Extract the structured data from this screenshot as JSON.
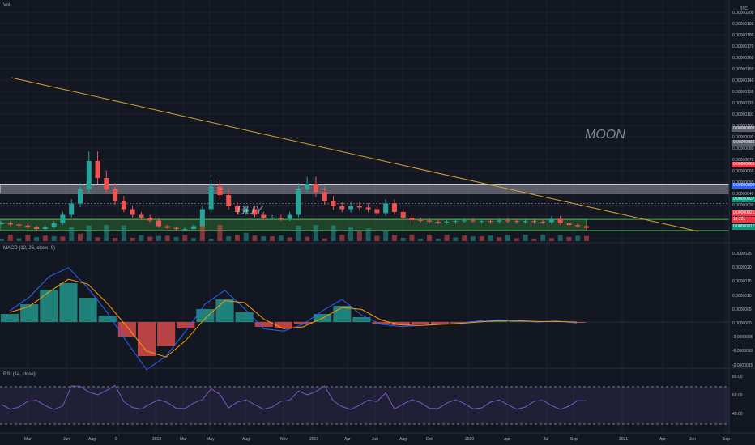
{
  "panes": {
    "volume_label": "Vol",
    "macd_label": "MACD (12, 26, close, 9)",
    "rsi_label": "RSI (14, close)"
  },
  "zones": {
    "moon": "MOON",
    "buy": "BUY"
  },
  "price_axis": {
    "currency": "BTC",
    "ticks": [
      "0.00000200",
      "0.00000190",
      "0.00000180",
      "0.00000170",
      "0.00000160",
      "0.00000150",
      "0.00000140",
      "0.00000130",
      "0.00000120",
      "0.00000110",
      "0.00000100",
      "0.00000090",
      "0.00000080",
      "0.00000070",
      "0.00000060",
      "0.00000050",
      "0.00000040",
      "0.00000030",
      "0.00000020",
      "0.00000010"
    ]
  },
  "price_tags": [
    {
      "text": "0.00000098",
      "color": "#5b5f6b"
    },
    {
      "text": "0.00000083",
      "color": "#5b5f6b"
    },
    {
      "text": "0.00000065",
      "color": "#f23645"
    },
    {
      "text": "0.00000050",
      "color": "#2962ff"
    },
    {
      "text": "0.00000037",
      "color": "#089981"
    },
    {
      "text": "0.00000021",
      "color": "#f23645"
    },
    {
      "text": "14.22k",
      "color": "#f23645"
    },
    {
      "text": "0.00000017",
      "color": "#089981"
    }
  ],
  "macd_axis": [
    "0.0000025",
    "0.0000020",
    "0.0000015",
    "0.0000010",
    "0.0000005",
    "0.0000000",
    "-0.0000005",
    "-0.0000010",
    "-0.0000015"
  ],
  "rsi_axis": [
    "80.00",
    "60.00",
    "40.00"
  ],
  "time_axis": [
    "Mar",
    "Jun",
    "Aug",
    "9",
    "2018",
    "Mar",
    "May",
    "Aug",
    "Nov",
    "2019",
    "Apr",
    "Jun",
    "Aug",
    "Oct",
    "2020",
    "Apr",
    "Jul",
    "Sep",
    "2021",
    "Apr",
    "Jun",
    "Sep"
  ],
  "colors": {
    "up": "#26a69a",
    "down": "#ef5350",
    "trendline": "#d6a32c",
    "buy_zone": "#2e7d32",
    "moon_zone": "#9598a1",
    "macd": "#2962ff",
    "signal": "#ff9800",
    "rsi": "#7e57c2"
  },
  "chart_data": [
    {
      "type": "candlestick",
      "title": "",
      "note": "Approximate close series read from the chart (BTC)",
      "close": [
        3e-07,
        2.8e-07,
        2.6e-07,
        2.3e-07,
        2e-07,
        2.3e-07,
        3e-07,
        4.5e-07,
        6.5e-07,
        9e-07,
        1.4e-06,
        1.1e-06,
        9e-07,
        7e-07,
        5.5e-07,
        4.5e-07,
        4e-07,
        3.5e-07,
        2.5e-07,
        2.2e-07,
        2e-07,
        2e-07,
        2.5e-07,
        5.5e-07,
        9.5e-07,
        8e-07,
        6e-07,
        5e-07,
        5.5e-07,
        4.5e-07,
        4e-07,
        4e-07,
        3.8e-07,
        4.5e-07,
        9e-07,
        1e-06,
        8.5e-07,
        7e-07,
        6e-07,
        5.5e-07,
        6e-07,
        5.8e-07,
        5.5e-07,
        4.8e-07,
        6.5e-07,
        5e-07,
        4e-07,
        3.6e-07,
        3.5e-07,
        3.3e-07,
        3.2e-07,
        3.3e-07,
        3.4e-07,
        3.5e-07,
        3.4e-07,
        3.4e-07,
        3.3e-07,
        3.5e-07,
        3.4e-07,
        3.3e-07,
        3.4e-07,
        3.3e-07,
        3.2e-07,
        3.8e-07,
        3e-07,
        2.7e-07,
        2.5e-07,
        2.2e-07
      ]
    },
    {
      "type": "area",
      "title": "Zones",
      "series": [
        {
          "name": "MOON",
          "values": [
            8.3e-07,
            9.8e-07
          ]
        },
        {
          "name": "BUY",
          "values": [
            1.7e-07,
            3.7e-07
          ]
        }
      ]
    }
  ]
}
